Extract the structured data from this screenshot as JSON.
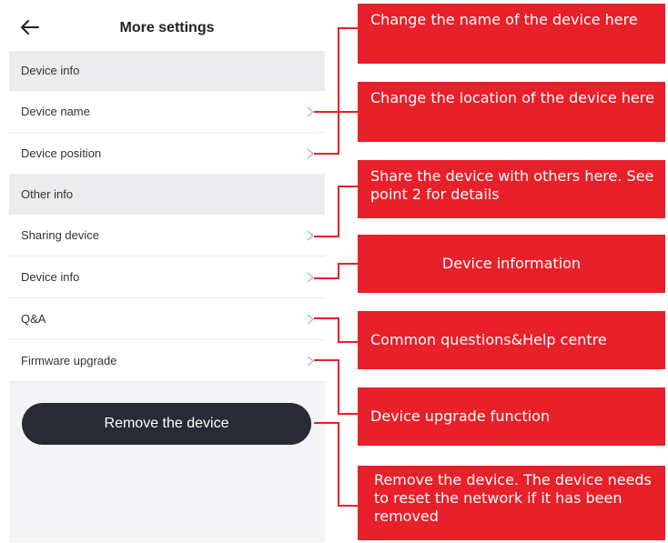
{
  "header": {
    "title": "More settings"
  },
  "sections": {
    "device_info_header": "Device info",
    "other_info_header": "Other info"
  },
  "rows": {
    "device_name": "Device name",
    "device_position": "Device position",
    "sharing_device": "Sharing device",
    "device_info": "Device info",
    "qa": "Q&A",
    "firmware_upgrade": "Firmware upgrade"
  },
  "remove_button": "Remove the device",
  "callouts": {
    "name": "Change the name of the device here",
    "location": "Change the location of the device here",
    "share": "Share the device with others here. See point 2 for details",
    "info": "Device information",
    "qa": "Common questions&Help centre",
    "upgrade": "Device upgrade function",
    "remove": "Remove the device. The device needs to reset the network if it has been removed"
  },
  "colors": {
    "callout": "#e8202a",
    "button": "#282a35",
    "section_bg": "#ececef"
  },
  "icons": {
    "back": "arrow-left-icon",
    "chevron": "chevron-right-icon"
  }
}
